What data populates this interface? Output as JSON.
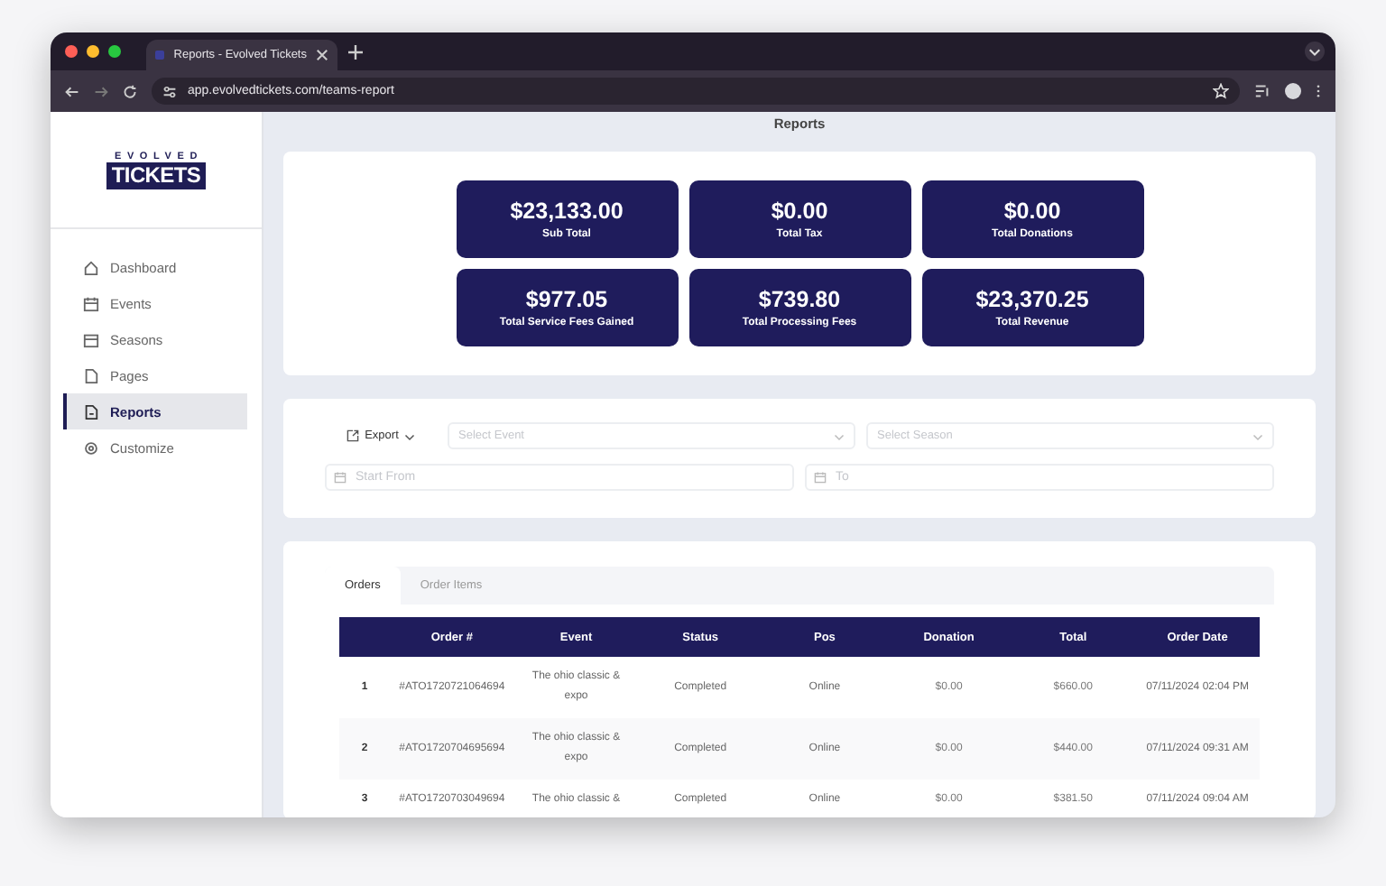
{
  "browser": {
    "tab_title": "Reports - Evolved Tickets",
    "url": "app.evolvedtickets.com/teams-report"
  },
  "sidebar": {
    "logo": {
      "top": "EVOLVED",
      "main": "TICKETS"
    },
    "items": [
      {
        "label": "Dashboard",
        "selected": false
      },
      {
        "label": "Events",
        "selected": false
      },
      {
        "label": "Seasons",
        "selected": false
      },
      {
        "label": "Pages",
        "selected": false
      },
      {
        "label": "Reports",
        "selected": true
      },
      {
        "label": "Customize",
        "selected": false
      }
    ]
  },
  "page_title": "Reports",
  "stats": [
    {
      "value": "$23,133.00",
      "label": "Sub Total"
    },
    {
      "value": "$0.00",
      "label": "Total Tax"
    },
    {
      "value": "$0.00",
      "label": "Total Donations"
    },
    {
      "value": "$977.05",
      "label": "Total Service Fees Gained"
    },
    {
      "value": "$739.80",
      "label": "Total Processing Fees"
    },
    {
      "value": "$23,370.25",
      "label": "Total Revenue"
    }
  ],
  "filters": {
    "export": "Export",
    "event_select": {
      "placeholder": "Select Event"
    },
    "season_select": {
      "placeholder": "Select Season"
    },
    "start_date": {
      "placeholder": "Start From"
    },
    "end_date": {
      "placeholder": "To"
    }
  },
  "table": {
    "tabs": [
      {
        "label": "Orders",
        "selected": true
      },
      {
        "label": "Order Items",
        "selected": false
      }
    ],
    "columns": [
      "Order #",
      "Event",
      "Status",
      "Pos",
      "Donation",
      "Total",
      "Order Date"
    ],
    "rows": [
      {
        "index": "1",
        "cells": [
          "#ATO1720721064694",
          "The ohio classic & expo",
          "Completed",
          "Online",
          "$0.00",
          "$660.00",
          "07/11/2024 02:04 PM"
        ]
      },
      {
        "index": "2",
        "cells": [
          "#ATO1720704695694",
          "The ohio classic & expo",
          "Completed",
          "Online",
          "$0.00",
          "$440.00",
          "07/11/2024 09:31 AM"
        ]
      },
      {
        "index": "3",
        "cells": [
          "#ATO1720703049694",
          "The ohio classic &",
          "Completed",
          "Online",
          "$0.00",
          "$381.50",
          "07/11/2024 09:04 AM"
        ]
      }
    ]
  }
}
